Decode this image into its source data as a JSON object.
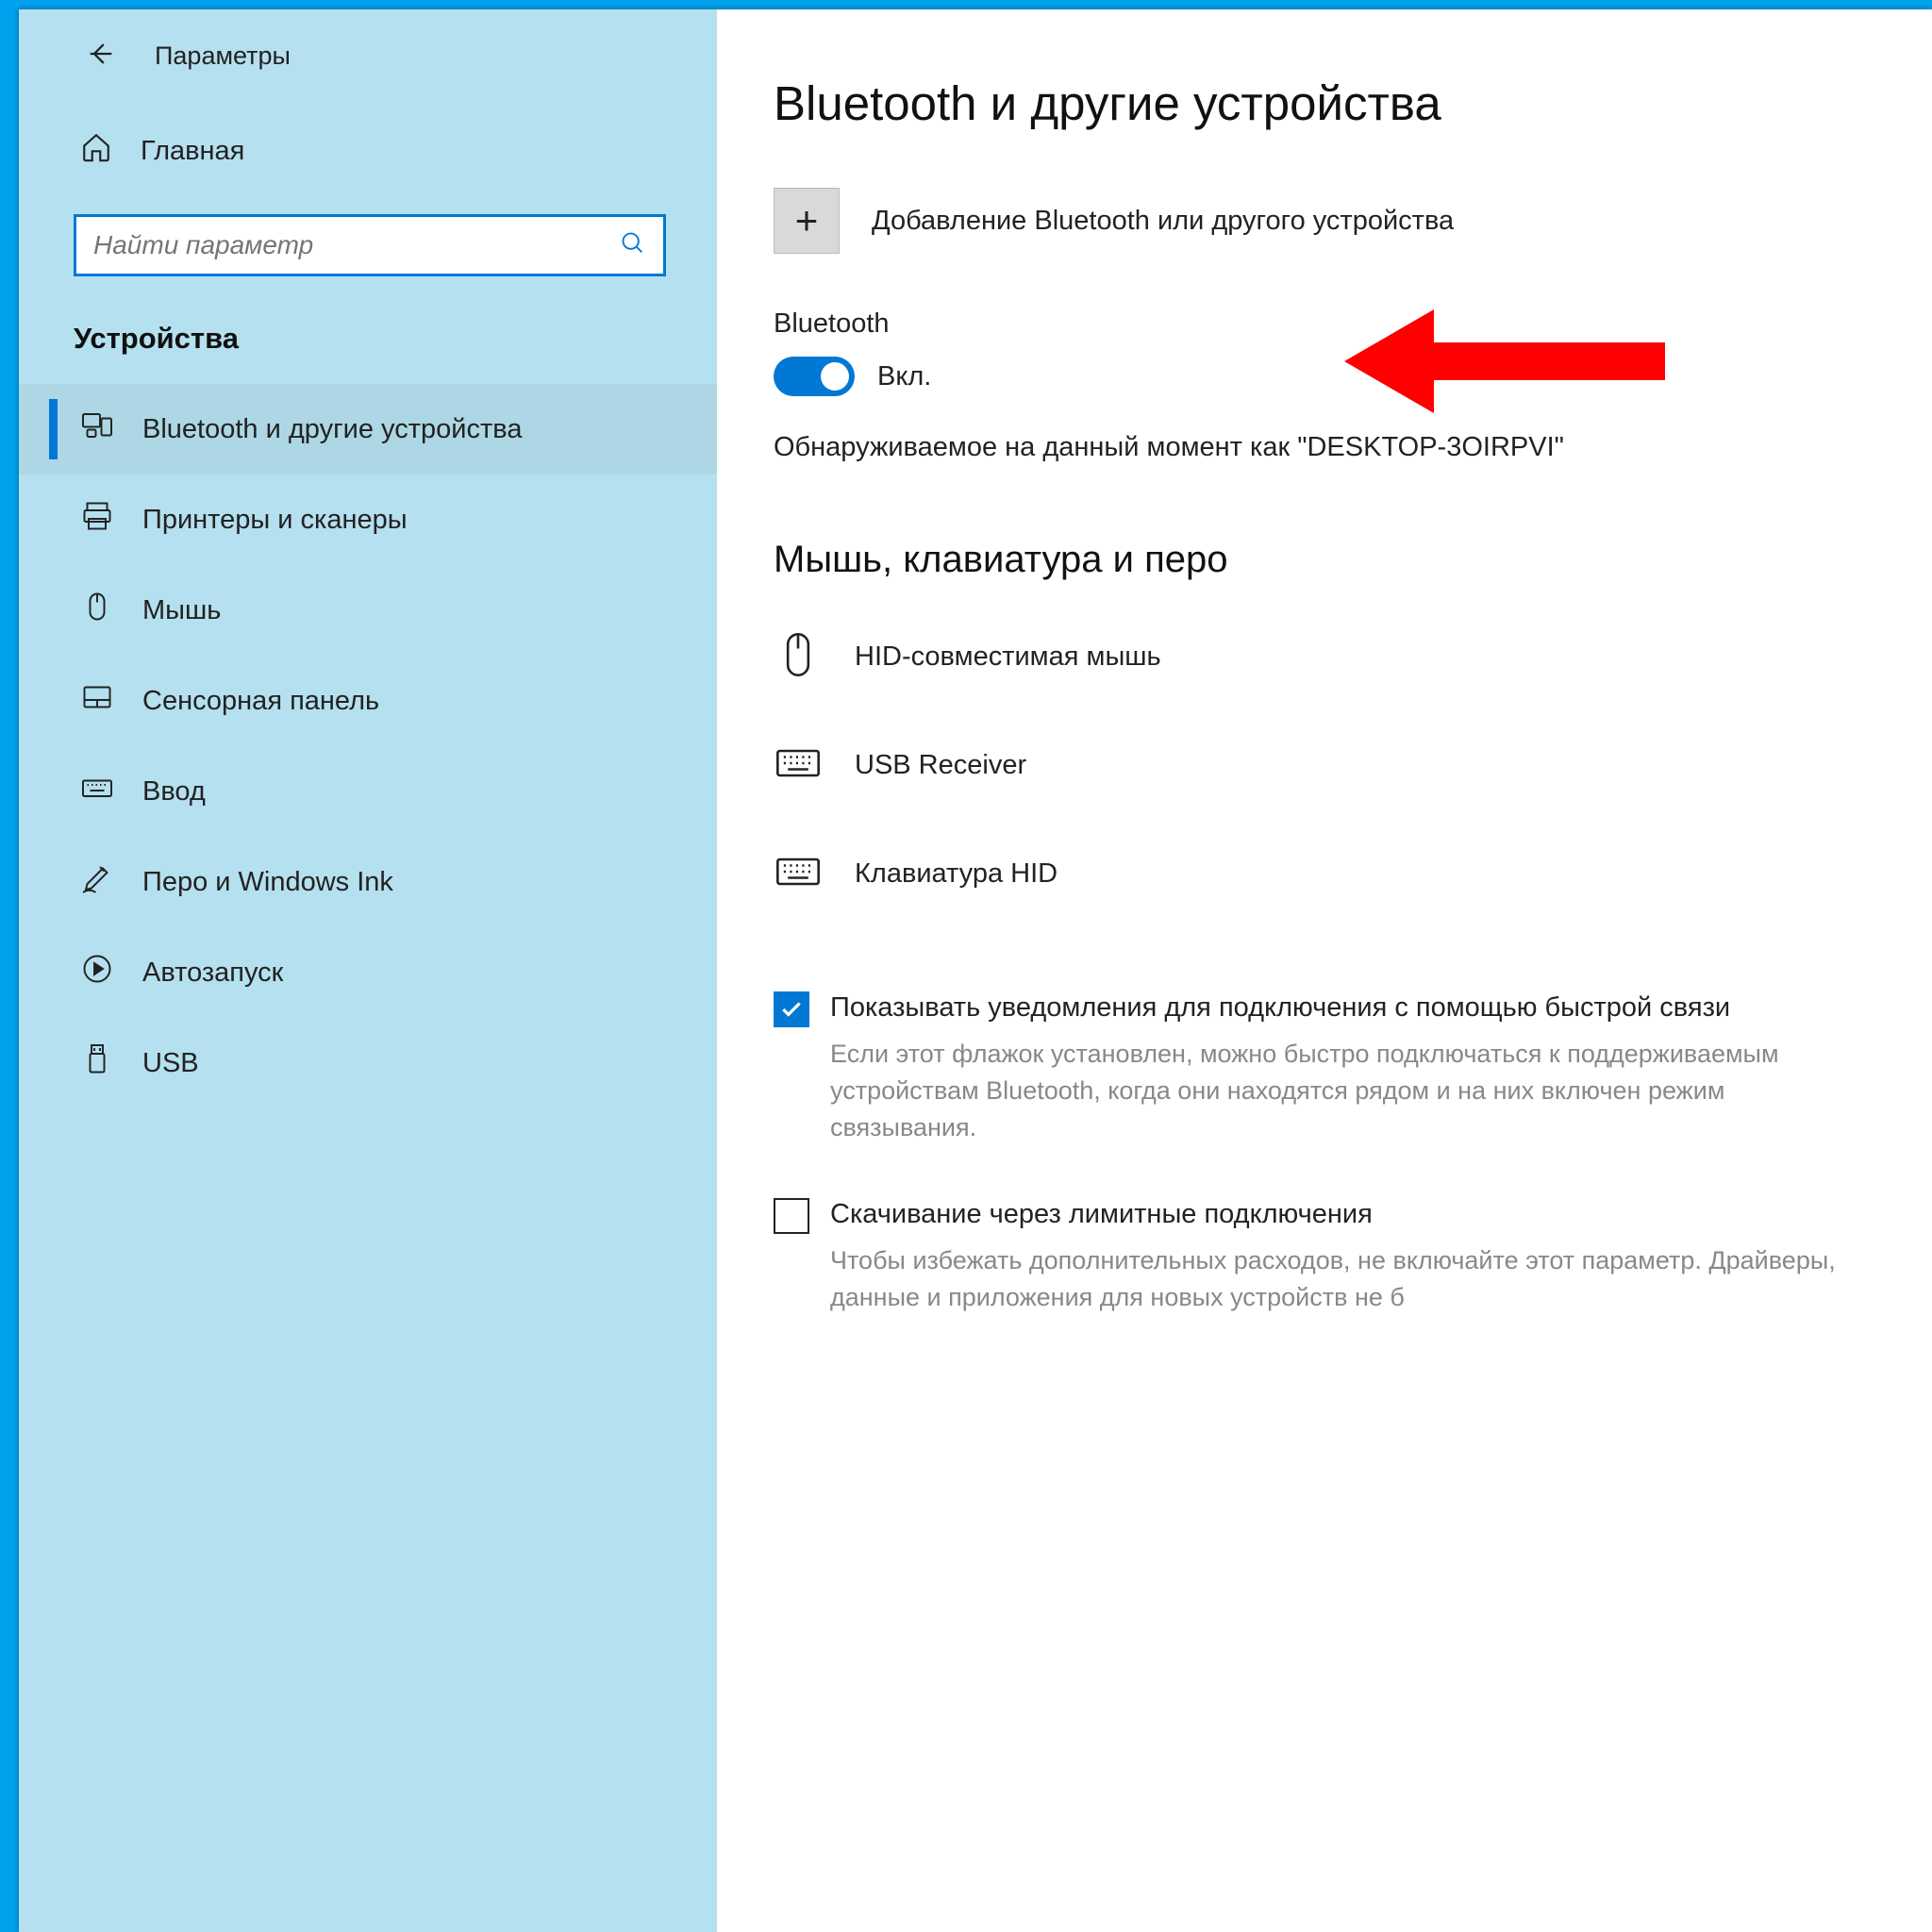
{
  "header": {
    "window_title": "Параметры",
    "home_label": "Главная",
    "search_placeholder": "Найти параметр",
    "category": "Устройства"
  },
  "nav": {
    "items": [
      {
        "id": "bluetooth",
        "label": "Bluetooth и другие устройства"
      },
      {
        "id": "printers",
        "label": "Принтеры и сканеры"
      },
      {
        "id": "mouse",
        "label": "Мышь"
      },
      {
        "id": "touchpad",
        "label": "Сенсорная панель"
      },
      {
        "id": "typing",
        "label": "Ввод"
      },
      {
        "id": "pen",
        "label": "Перо и Windows Ink"
      },
      {
        "id": "autoplay",
        "label": "Автозапуск"
      },
      {
        "id": "usb",
        "label": "USB"
      }
    ]
  },
  "main": {
    "title": "Bluetooth и другие устройства",
    "add_button_glyph": "+",
    "add_label": "Добавление Bluetooth или другого устройства",
    "bt_heading": "Bluetooth",
    "toggle_state_label": "Вкл.",
    "discoverable_text": "Обнаруживаемое на данный момент как \"DESKTOP-3OIRPVI\"",
    "devices_heading": "Мышь, клавиатура и перо",
    "devices": [
      {
        "icon": "mouse",
        "label": "HID-совместимая мышь"
      },
      {
        "icon": "keyboard",
        "label": "USB Receiver"
      },
      {
        "icon": "keyboard",
        "label": "Клавиатура HID"
      }
    ],
    "swift_pair": {
      "checked": true,
      "label": "Показывать уведомления для подключения с помощью быстрой связи",
      "desc": "Если этот флажок установлен, можно быстро подключаться к поддерживаемым устройствам Bluetooth, когда они находятся рядом и на них включен режим связывания."
    },
    "metered": {
      "checked": false,
      "label": "Скачивание через лимитные подключения",
      "desc": "Чтобы избежать дополнительных расходов, не включайте этот параметр. Драйверы, данные и приложения для новых устройств не б"
    }
  }
}
